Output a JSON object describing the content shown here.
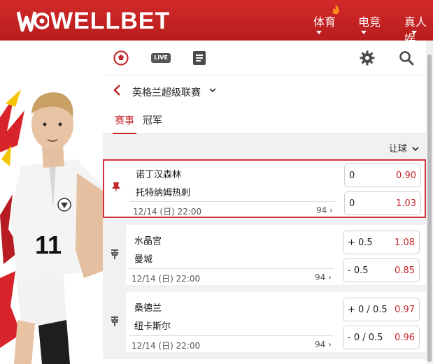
{
  "brand": {
    "name": "WELLBET",
    "accent": "#c3272b",
    "nav_bg": "#c82424"
  },
  "nav": {
    "items": [
      {
        "label": "体育",
        "icon": "flame-icon"
      },
      {
        "label": "电竞"
      },
      {
        "label": "真人娱"
      }
    ]
  },
  "toolbar": {
    "icons": [
      "soccer-ball-icon",
      "live-icon",
      "betslip-icon",
      "gear-icon",
      "search-icon"
    ],
    "live_label": "LIVE"
  },
  "league": {
    "name": "英格兰超级联赛",
    "back_icon": "chevron-left-icon",
    "dropdown_icon": "chevron-down-icon"
  },
  "tabs": [
    {
      "label": "赛事",
      "active": true
    },
    {
      "label": "冠军",
      "active": false
    }
  ],
  "filter": {
    "label": "让球"
  },
  "matches": [
    {
      "home": "诺丁汉森林",
      "away": "托特纳姆热刺",
      "time": "12/14 (日) 22:00",
      "more": "94",
      "pinned": true,
      "odds": [
        {
          "handicap": "0",
          "price": "0.90"
        },
        {
          "handicap": "0",
          "price": "1.03"
        }
      ]
    },
    {
      "home": "水晶宫",
      "away": "曼城",
      "time": "12/14 (日) 22:00",
      "more": "94",
      "pinned": false,
      "odds": [
        {
          "handicap": "+ 0.5",
          "price": "1.08"
        },
        {
          "handicap": "- 0.5",
          "price": "0.85"
        }
      ]
    },
    {
      "home": "桑德兰",
      "away": "纽卡斯尔",
      "time": "12/14 (日) 22:00",
      "more": "94",
      "pinned": false,
      "odds": [
        {
          "handicap": "+ 0 / 0.5",
          "price": "0.97"
        },
        {
          "handicap": "- 0 / 0.5",
          "price": "0.96"
        }
      ]
    }
  ]
}
